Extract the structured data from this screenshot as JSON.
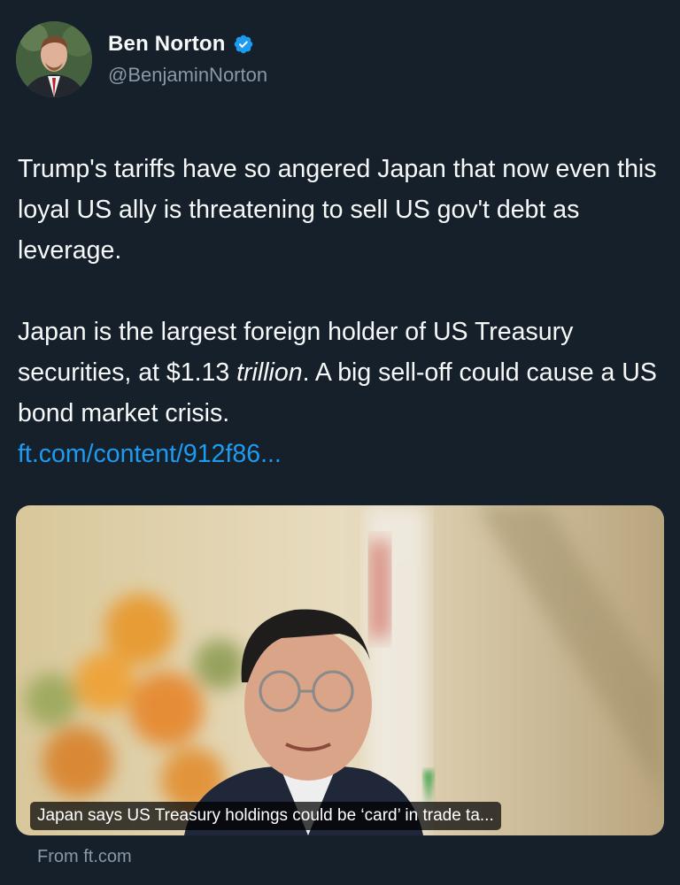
{
  "author": {
    "display_name": "Ben Norton",
    "handle": "@BenjaminNorton",
    "verified_badge_icon": "verified-check-icon",
    "accent_color": "#1d9bf0"
  },
  "tweet": {
    "paragraph1": "Trump's tariffs have so angered Japan that now even this loyal US ally is threatening to sell US gov't debt as leverage.",
    "paragraph2_before": "Japan is the largest foreign holder of US Treasury securities, at $1.13 ",
    "paragraph2_emphasis": "trillion",
    "paragraph2_after": ". A big sell-off could cause a US bond market crisis.",
    "link_text": "ft.com/content/912f86..."
  },
  "link_card": {
    "caption": "Japan says US Treasury holdings could be ‘card’ in trade ta...",
    "source": "From ft.com"
  }
}
